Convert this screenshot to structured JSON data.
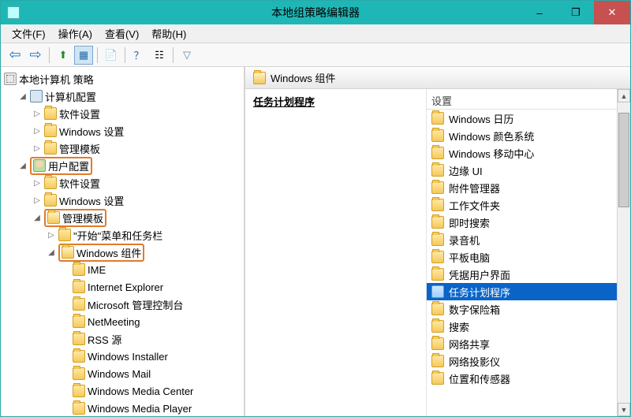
{
  "window": {
    "title": "本地组策略编辑器",
    "minimize": "–",
    "maximize": "❐",
    "close": "✕"
  },
  "menu": {
    "file": "文件(F)",
    "action": "操作(A)",
    "view": "查看(V)",
    "help": "帮助(H)"
  },
  "toolbar": {
    "back": "←",
    "forward": "→",
    "up": "↑",
    "folders": "▥",
    "export": "▤",
    "refresh": "?",
    "props": "☰",
    "filter": "▼"
  },
  "tree": {
    "root": "本地计算机 策略",
    "computer_config": "计算机配置",
    "software_settings": "软件设置",
    "windows_settings": "Windows 设置",
    "admin_templates": "管理模板",
    "user_config": "用户配置",
    "start_menu_taskbar": "\"开始\"菜单和任务栏",
    "windows_components": "Windows 组件",
    "items": {
      "ime": "IME",
      "ie": "Internet Explorer",
      "ms_console": "Microsoft 管理控制台",
      "netmeeting": "NetMeeting",
      "rss": "RSS 源",
      "win_installer": "Windows Installer",
      "win_mail": "Windows Mail",
      "win_media_center": "Windows Media Center",
      "win_media_player": "Windows Media Player"
    }
  },
  "right": {
    "header": "Windows 组件",
    "selected_name": "任务计划程序",
    "settings_header": "设置",
    "items": [
      {
        "label": "Windows 日历",
        "selected": false
      },
      {
        "label": "Windows 颜色系统",
        "selected": false
      },
      {
        "label": "Windows 移动中心",
        "selected": false
      },
      {
        "label": "边缘 UI",
        "selected": false
      },
      {
        "label": "附件管理器",
        "selected": false
      },
      {
        "label": "工作文件夹",
        "selected": false
      },
      {
        "label": "即时搜索",
        "selected": false
      },
      {
        "label": "录音机",
        "selected": false
      },
      {
        "label": "平板电脑",
        "selected": false
      },
      {
        "label": "凭据用户界面",
        "selected": false
      },
      {
        "label": "任务计划程序",
        "selected": true
      },
      {
        "label": "数字保险箱",
        "selected": false
      },
      {
        "label": "搜索",
        "selected": false
      },
      {
        "label": "网络共享",
        "selected": false
      },
      {
        "label": "网络投影仪",
        "selected": false
      },
      {
        "label": "位置和传感器",
        "selected": false
      }
    ]
  }
}
